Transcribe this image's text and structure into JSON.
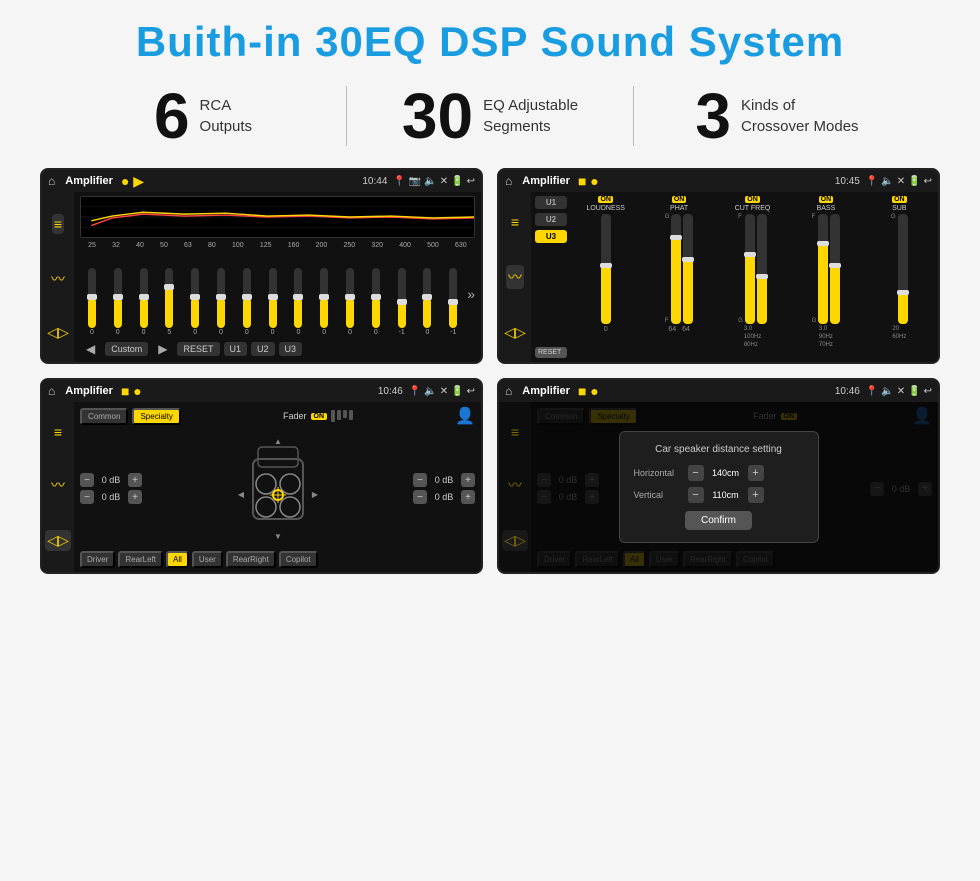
{
  "page": {
    "title": "Buith-in 30EQ DSP Sound System",
    "stats": [
      {
        "number": "6",
        "desc_line1": "RCA",
        "desc_line2": "Outputs"
      },
      {
        "number": "30",
        "desc_line1": "EQ Adjustable",
        "desc_line2": "Segments"
      },
      {
        "number": "3",
        "desc_line1": "Kinds of",
        "desc_line2": "Crossover Modes"
      }
    ]
  },
  "screen1": {
    "topbar": {
      "title": "Amplifier",
      "time": "10:44"
    },
    "eq_freqs": [
      "25",
      "32",
      "40",
      "50",
      "63",
      "80",
      "100",
      "125",
      "160",
      "200",
      "250",
      "320",
      "400",
      "500",
      "630"
    ],
    "eq_values": [
      "0",
      "0",
      "0",
      "5",
      "0",
      "0",
      "0",
      "0",
      "0",
      "0",
      "0",
      "0",
      "-1",
      "0",
      "-1"
    ],
    "bottom_buttons": [
      "Custom",
      "RESET",
      "U1",
      "U2",
      "U3"
    ]
  },
  "screen2": {
    "topbar": {
      "title": "Amplifier",
      "time": "10:45"
    },
    "presets": [
      "U1",
      "U2",
      "U3"
    ],
    "channels": [
      {
        "label": "LOUDNESS",
        "on": true
      },
      {
        "label": "PHAT",
        "on": true
      },
      {
        "label": "CUT FREQ",
        "on": true
      },
      {
        "label": "BASS",
        "on": true
      },
      {
        "label": "SUB",
        "on": true
      }
    ],
    "reset_label": "RESET"
  },
  "screen3": {
    "topbar": {
      "title": "Amplifier",
      "time": "10:46"
    },
    "tabs": [
      "Common",
      "Specialty"
    ],
    "fader_label": "Fader",
    "fader_on": "ON",
    "db_values": [
      "0 dB",
      "0 dB",
      "0 dB",
      "0 dB"
    ],
    "nav_buttons": [
      "Driver",
      "RearLeft",
      "All",
      "User",
      "RearRight",
      "Copilot"
    ]
  },
  "screen4": {
    "topbar": {
      "title": "Amplifier",
      "time": "10:46"
    },
    "tabs": [
      "Common",
      "Specialty"
    ],
    "dialog": {
      "title": "Car speaker distance setting",
      "rows": [
        {
          "label": "Horizontal",
          "value": "140cm"
        },
        {
          "label": "Vertical",
          "value": "110cm"
        }
      ],
      "confirm_label": "Confirm"
    },
    "db_values": [
      "0 dB",
      "0 dB"
    ],
    "nav_buttons": [
      "Driver",
      "RearLeft",
      "All",
      "User",
      "RearRight",
      "Copilot"
    ]
  }
}
